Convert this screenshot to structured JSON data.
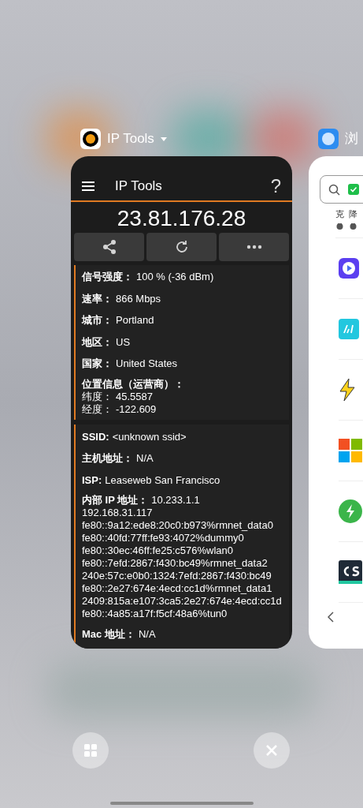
{
  "apps": [
    {
      "name": "IP Tools",
      "has_menu": true
    },
    {
      "name": "浏",
      "has_menu": false
    }
  ],
  "ip_tools": {
    "title": "IP Tools",
    "help": "?",
    "ip": "23.81.176.28",
    "info": [
      {
        "label": "信号强度：",
        "value": "100 % (-36 dBm)"
      },
      {
        "label": "速率：",
        "value": "866 Mbps"
      },
      {
        "label": "城市：",
        "value": "Portland"
      },
      {
        "label": "地区：",
        "value": "US"
      },
      {
        "label": "国家：",
        "value": "United States"
      }
    ],
    "location": {
      "label": "位置信息（运营商）：",
      "lines": [
        {
          "label": "纬度：",
          "value": "45.5587"
        },
        {
          "label": "经度：",
          "value": "-122.609"
        }
      ]
    },
    "network": [
      {
        "label": "SSID:",
        "value": "<unknown ssid>"
      },
      {
        "label": "主机地址：",
        "value": "N/A"
      },
      {
        "label": "ISP:",
        "value": "Leaseweb San Francisco"
      }
    ],
    "internal_ip": {
      "label": "内部 IP 地址：",
      "value": "10.233.1.1",
      "addresses": [
        "192.168.31.117",
        "fe80::9a12:ede8:20c0:b973%rmnet_data0",
        "fe80::40fd:77ff:fe93:4072%dummy0",
        "fe80::30ec:46ff:fe25:c576%wlan0",
        "fe80::7efd:2867:f430:bc49%rmnet_data2",
        "240e:57c:e0b0:1324:7efd:2867:f430:bc49",
        "fe80::2e27:674e:4ecd:cc1d%rmnet_data1",
        "2409:815a:e107:3ca5:2e27:674e:4ecd:cc1d",
        "fe80::4a85:a17f:f5cf:48a6%tun0"
      ]
    },
    "mac": {
      "label": "Mac 地址：",
      "value": "N/A"
    }
  },
  "browser": {
    "shortcuts": [
      "克",
      "降"
    ]
  }
}
